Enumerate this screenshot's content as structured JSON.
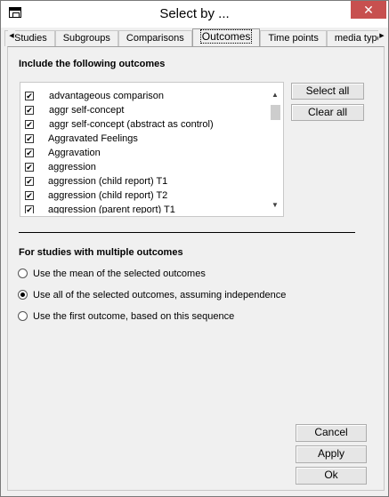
{
  "window": {
    "title": "Select by ...",
    "close_glyph": "✕",
    "icon": "app-window-icon"
  },
  "tabs": {
    "scroll_left_glyph": "◀",
    "scroll_right_glyph": "▶",
    "items": [
      {
        "label": "Studies",
        "active": false
      },
      {
        "label": "Subgroups",
        "active": false
      },
      {
        "label": "Comparisons",
        "active": false
      },
      {
        "label": "Outcomes",
        "active": true
      },
      {
        "label": "Time points",
        "active": false
      },
      {
        "label": "media type",
        "active": false
      }
    ]
  },
  "outcomes": {
    "heading": "Include the following outcomes",
    "items": [
      {
        "label": "advantageous comparison",
        "checked": true
      },
      {
        "label": "aggr self-concept",
        "checked": true
      },
      {
        "label": "aggr self-concept (abstract as control)",
        "checked": true
      },
      {
        "label": "Aggravated Feelings",
        "checked": true
      },
      {
        "label": "Aggravation",
        "checked": true
      },
      {
        "label": "aggression",
        "checked": true
      },
      {
        "label": "aggression (child report) T1",
        "checked": true
      },
      {
        "label": "aggression (child report) T2",
        "checked": true
      },
      {
        "label": "aggression (parent report) T1",
        "checked": true
      }
    ],
    "check_glyph": "✔",
    "scroll_up_glyph": "▲",
    "scroll_down_glyph": "▼",
    "select_all_label": "Select all",
    "clear_all_label": "Clear all"
  },
  "multiple": {
    "heading": "For studies with multiple outcomes",
    "options": [
      {
        "label": "Use the mean of the selected outcomes",
        "selected": false
      },
      {
        "label": "Use all of the selected outcomes, assuming independence",
        "selected": true
      },
      {
        "label": "Use the first outcome, based on this sequence",
        "selected": false
      }
    ]
  },
  "footer": {
    "cancel_label": "Cancel",
    "apply_label": "Apply",
    "ok_label": "Ok"
  }
}
